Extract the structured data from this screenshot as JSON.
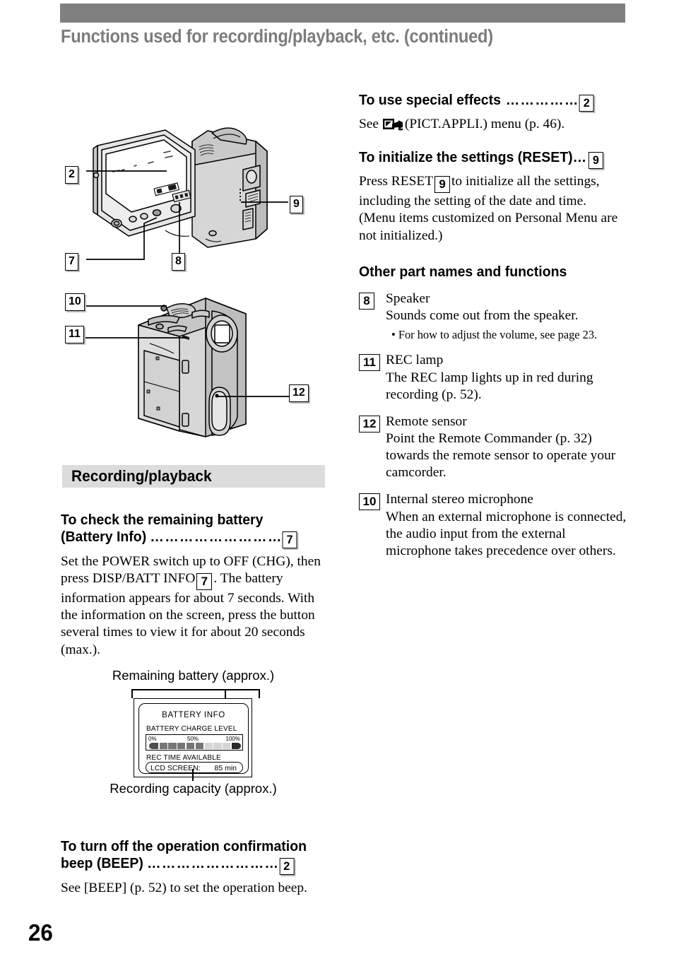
{
  "page": {
    "running_head": "Functions used for recording/playback, etc. (continued)",
    "number": "26"
  },
  "figures": {
    "top": {
      "name": "camcorder-lcd-open-illustration",
      "callouts": [
        "2",
        "7",
        "8",
        "9"
      ]
    },
    "bottom": {
      "name": "camcorder-rear-illustration",
      "callouts": [
        "10",
        "11",
        "12"
      ]
    },
    "battery_info": {
      "caption_top": "Remaining battery (approx.)",
      "caption_bottom": "Recording capacity (approx.)",
      "screen": {
        "title": "BATTERY INFO",
        "charge_label": "BATTERY CHARGE LEVEL",
        "ticks": [
          "0%",
          "50%",
          "100%"
        ],
        "rec_label": "REC TIME AVAILABLE",
        "rec_item": "LCD SCREEN:",
        "rec_value": "85 min"
      }
    }
  },
  "left_column": {
    "section_band": "Recording/playback",
    "battery_check": {
      "heading_line1": "To check the remaining battery",
      "heading_line2": "(Battery Info)",
      "leader": " ………………………",
      "callout": "7",
      "body_1": "Set the POWER switch up to OFF (CHG),",
      "body_2_before": "then press DISP/BATT INFO",
      "body_2_callout": "7",
      "body_2_after": ". The",
      "body_3": "battery information appears for about 7 seconds. With the information on the screen, press the button several times to view it for about 20 seconds (max.)."
    },
    "beep": {
      "heading_line1": "To turn off the operation confirmation",
      "heading_line2": "beep (BEEP)",
      "leader": " ………………………",
      "callout": "2",
      "body": "See [BEEP] (p. 52) to set the operation beep."
    }
  },
  "right_column": {
    "special_effects": {
      "heading": "To use special effects",
      "leader": " ……………",
      "callout": "2",
      "body_before": "See",
      "body_after": "(PICT.APPLI.) menu (p. 46)."
    },
    "reset": {
      "heading": "To initialize the settings (RESET)…",
      "callout": "9",
      "body_before": "Press RESET",
      "body_callout": "9",
      "body_after": "to initialize all the settings, including the setting of the date and time.",
      "body_2": "(Menu items customized on Personal Menu are not initialized.)"
    },
    "other_parts": {
      "heading": "Other part names and functions",
      "items": [
        {
          "number": "8",
          "term": "Speaker",
          "desc": "Sounds come out from the speaker.",
          "note": "• For how to adjust the volume, see page 23."
        },
        {
          "number": "11",
          "term": "REC lamp",
          "desc": "The REC lamp lights up in red during recording (p. 52).",
          "note": ""
        },
        {
          "number": "12",
          "term": "Remote sensor",
          "desc": "Point the Remote Commander (p. 32) towards the remote sensor to operate your camcorder.",
          "note": ""
        },
        {
          "number": "10",
          "term": "Internal stereo microphone",
          "desc": "When an external microphone is connected, the audio input from the external microphone takes precedence over others.",
          "note": ""
        }
      ]
    }
  },
  "colors": {
    "head_bar": "#808080",
    "head_text": "#7c7c7c",
    "band": "#dcdcdc",
    "text": "#000000"
  }
}
